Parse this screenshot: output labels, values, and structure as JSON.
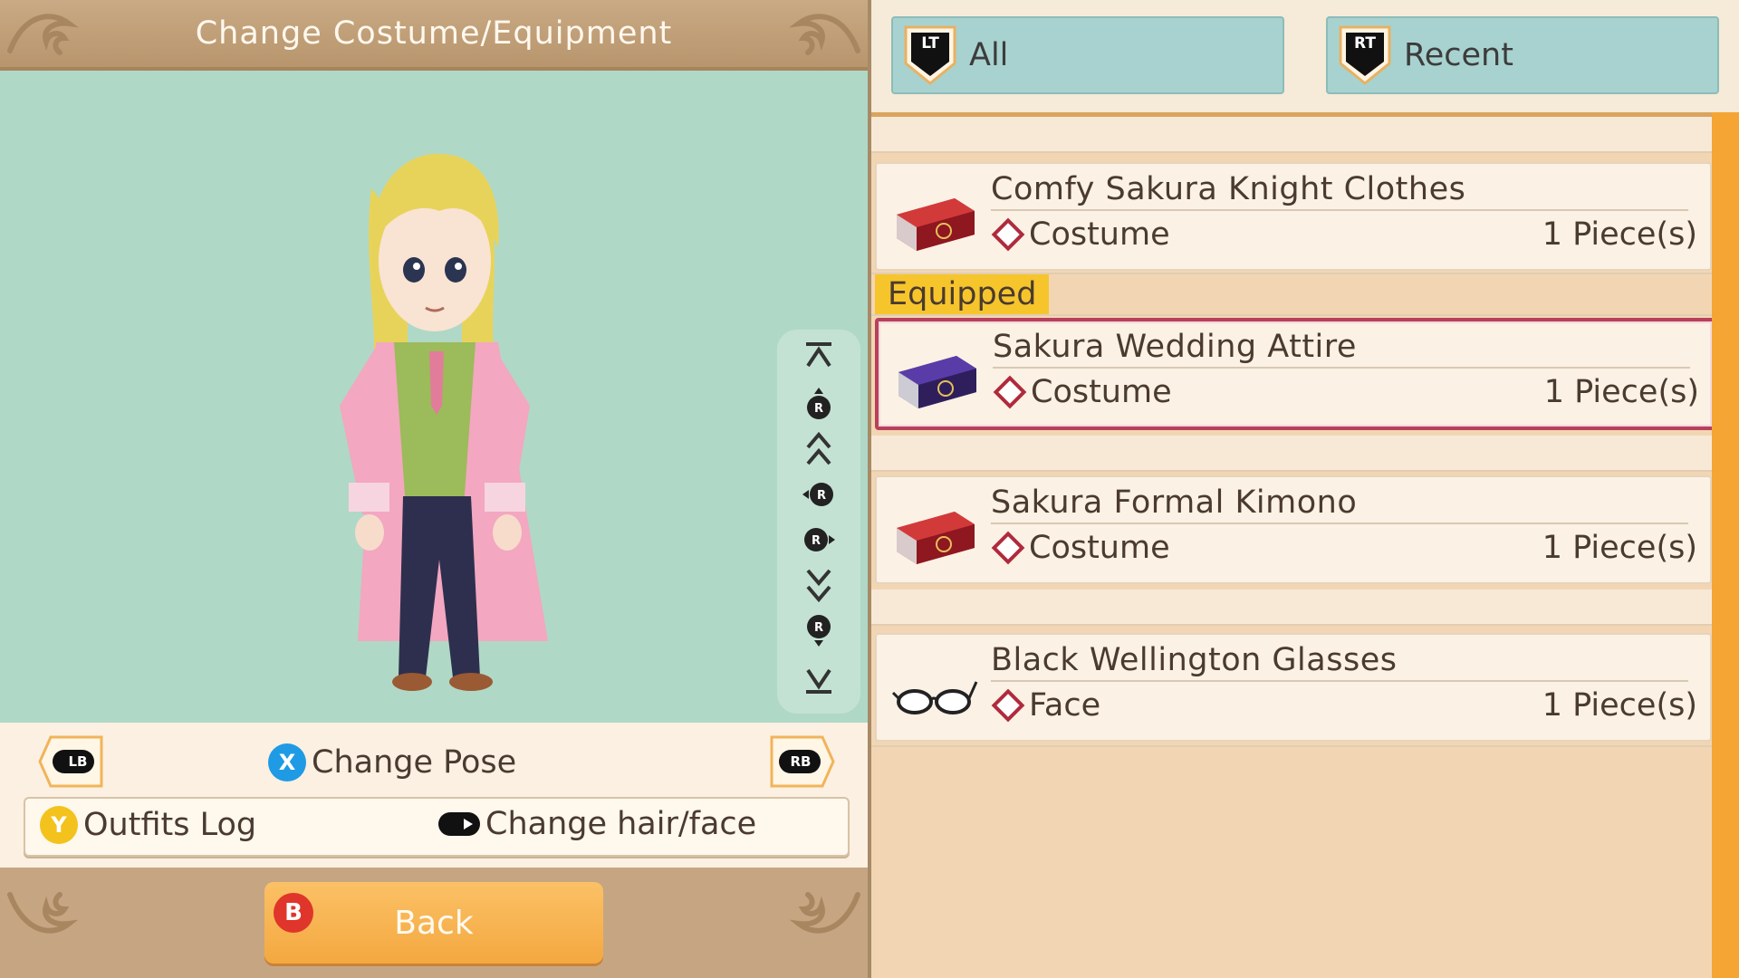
{
  "header": {
    "title": "Change Costume/Equipment"
  },
  "controls": {
    "lb_label": "LB",
    "rb_label": "RB",
    "x_button": "X",
    "change_pose": "Change Pose",
    "y_button": "Y",
    "outfits_log": "Outfits Log",
    "change_hair_face": "Change hair/face"
  },
  "footer": {
    "b_button": "B",
    "back_label": "Back"
  },
  "filters": [
    {
      "trigger": "LT",
      "label": "All"
    },
    {
      "trigger": "RT",
      "label": "Recent"
    }
  ],
  "equipped_tag": "Equipped",
  "items": [
    {
      "name": "Comfy Sakura Knight Clothes",
      "category": "Costume",
      "quantity": "1 Piece(s)",
      "icon": "red-case-icon"
    },
    {
      "name": "Sakura Wedding Attire",
      "category": "Costume",
      "quantity": "1 Piece(s)",
      "icon": "purple-case-icon",
      "equipped": true
    },
    {
      "name": "Sakura Formal Kimono",
      "category": "Costume",
      "quantity": "1 Piece(s)",
      "icon": "red-case-icon"
    },
    {
      "name": "Black Wellington Glasses",
      "category": "Face",
      "quantity": "1 Piece(s)",
      "icon": "glasses-icon"
    }
  ],
  "rail": {
    "stick_label": "R"
  },
  "colors": {
    "accent_orange": "#f4a534",
    "selected_border": "#b8405a",
    "preview_bg": "#b0d8c6",
    "equipped_tag": "#f6c52c"
  }
}
